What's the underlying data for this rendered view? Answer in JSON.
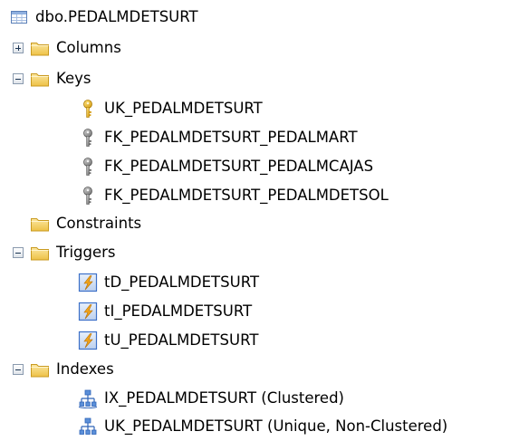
{
  "tree": {
    "table": {
      "label": "dbo.PEDALMDETSURT",
      "icon": "table-icon"
    },
    "columns": {
      "label": "Columns",
      "icon": "folder-icon",
      "expanded": false
    },
    "keys": {
      "label": "Keys",
      "icon": "folder-icon",
      "expanded": true,
      "items": [
        {
          "label": "UK_PEDALMDETSURT",
          "icon": "primary-key-icon"
        },
        {
          "label": "FK_PEDALMDETSURT_PEDALMART",
          "icon": "foreign-key-icon"
        },
        {
          "label": "FK_PEDALMDETSURT_PEDALMCAJAS",
          "icon": "foreign-key-icon"
        },
        {
          "label": "FK_PEDALMDETSURT_PEDALMDETSOL",
          "icon": "foreign-key-icon"
        }
      ]
    },
    "constraints": {
      "label": "Constraints",
      "icon": "folder-icon"
    },
    "triggers": {
      "label": "Triggers",
      "icon": "folder-icon",
      "expanded": true,
      "items": [
        {
          "label": "tD_PEDALMDETSURT",
          "icon": "trigger-icon"
        },
        {
          "label": "tI_PEDALMDETSURT",
          "icon": "trigger-icon"
        },
        {
          "label": "tU_PEDALMDETSURT",
          "icon": "trigger-icon"
        }
      ]
    },
    "indexes": {
      "label": "Indexes",
      "icon": "folder-icon",
      "expanded": true,
      "items": [
        {
          "label": "IX_PEDALMDETSURT (Clustered)",
          "icon": "clustered-index-icon"
        },
        {
          "label": "UK_PEDALMDETSURT (Unique, Non-Clustered)",
          "icon": "nonclustered-index-icon"
        }
      ]
    }
  },
  "colors": {
    "folder": "#f2cf57",
    "folder_dark": "#c99a1f",
    "key_gold": "#e8b720",
    "key_gray": "#8e8e8e",
    "trigger_blue": "#3d71c8",
    "trigger_bolt": "#f2a51a",
    "index_blue": "#2e63b8"
  }
}
